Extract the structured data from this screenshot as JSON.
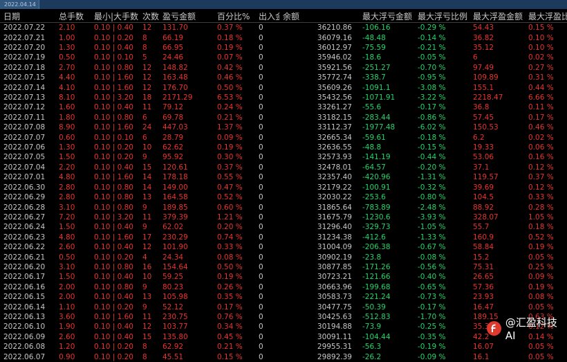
{
  "window": {
    "tab_label": "2022.04.14"
  },
  "columns": [
    "日期",
    "总手数",
    "最小|大手数",
    "次数",
    "盈亏金额",
    "百分比%",
    "出入金",
    "余额",
    "最大浮亏金额",
    "最大浮亏比例",
    "最大浮盈金额",
    "最大浮盈比例"
  ],
  "rows": [
    [
      "2022.07.22",
      "2.10",
      "0.10 | 0.40",
      "12",
      "131.70",
      "0.37 %",
      "0",
      "36210.86",
      "-106.16",
      "-0.29 %",
      "54.43",
      "0.15 %"
    ],
    [
      "2022.07.21",
      "1.00",
      "0.10 | 0.20",
      "8",
      "66.19",
      "0.18 %",
      "0",
      "36079.16",
      "-48.48",
      "-0.14 %",
      "36.82",
      "0.10 %"
    ],
    [
      "2022.07.20",
      "1.30",
      "0.10 | 0.40",
      "8",
      "66.95",
      "0.19 %",
      "0",
      "36012.97",
      "-75.59",
      "-0.21 %",
      "35.12",
      "0.10 %"
    ],
    [
      "2022.07.19",
      "0.50",
      "0.10 | 0.10",
      "5",
      "24.46",
      "0.07 %",
      "0",
      "35946.02",
      "-18.6",
      "-0.05 %",
      "6",
      "0.02 %"
    ],
    [
      "2022.07.18",
      "2.70",
      "0.10 | 0.80",
      "12",
      "148.82",
      "0.42 %",
      "0",
      "35921.56",
      "-251.27",
      "-0.70 %",
      "97.49",
      "0.27 %"
    ],
    [
      "2022.07.15",
      "4.40",
      "0.10 | 1.60",
      "12",
      "163.48",
      "0.46 %",
      "0",
      "35772.74",
      "-338.7",
      "-0.95 %",
      "109.89",
      "0.31 %"
    ],
    [
      "2022.07.14",
      "4.10",
      "0.10 | 1.60",
      "12",
      "176.70",
      "0.50 %",
      "0",
      "35609.26",
      "-1091.1",
      "-3.08 %",
      "155.1",
      "0.44 %"
    ],
    [
      "2022.07.13",
      "8.10",
      "0.10 | 3.20",
      "18",
      "2171.29",
      "6.53 %",
      "0",
      "35432.56",
      "-1071.91",
      "-3.22 %",
      "2218.47",
      "6.66 %"
    ],
    [
      "2022.07.12",
      "1.60",
      "0.10 | 0.40",
      "11",
      "79.12",
      "0.24 %",
      "0",
      "33261.27",
      "-55.6",
      "-0.17 %",
      "36.8",
      "0.11 %"
    ],
    [
      "2022.07.11",
      "1.80",
      "0.10 | 0.80",
      "6",
      "69.78",
      "0.21 %",
      "0",
      "33182.15",
      "-283.44",
      "-0.86 %",
      "57.45",
      "0.17 %"
    ],
    [
      "2022.07.08",
      "8.90",
      "0.10 | 1.60",
      "24",
      "447.03",
      "1.37 %",
      "0",
      "33112.37",
      "-1977.48",
      "-6.02 %",
      "150.53",
      "0.46 %"
    ],
    [
      "2022.07.07",
      "0.60",
      "0.10 | 0.10",
      "6",
      "28.79",
      "0.09 %",
      "0",
      "32665.34",
      "-59.61",
      "-0.18 %",
      "6.2",
      "0.02 %"
    ],
    [
      "2022.07.06",
      "1.30",
      "0.10 | 0.20",
      "10",
      "62.62",
      "0.19 %",
      "0",
      "32636.55",
      "-48.8",
      "-0.15 %",
      "19.33",
      "0.06 %"
    ],
    [
      "2022.07.05",
      "1.50",
      "0.10 | 0.20",
      "9",
      "95.92",
      "0.30 %",
      "0",
      "32573.93",
      "-141.19",
      "-0.44 %",
      "53.06",
      "0.16 %"
    ],
    [
      "2022.07.04",
      "2.20",
      "0.10 | 0.40",
      "15",
      "120.61",
      "0.37 %",
      "0",
      "32478.01",
      "-64.57",
      "-0.20 %",
      "37.1",
      "0.12 %"
    ],
    [
      "2022.07.01",
      "4.80",
      "0.10 | 1.60",
      "14",
      "178.18",
      "0.55 %",
      "0",
      "32357.40",
      "-420.96",
      "-1.31 %",
      "119.57",
      "0.37 %"
    ],
    [
      "2022.06.30",
      "2.80",
      "0.10 | 0.80",
      "14",
      "149.00",
      "0.47 %",
      "0",
      "32179.22",
      "-100.91",
      "-0.32 %",
      "39.69",
      "0.12 %"
    ],
    [
      "2022.06.29",
      "2.80",
      "0.10 | 0.80",
      "13",
      "164.58",
      "0.52 %",
      "0",
      "32030.22",
      "-253.6",
      "-0.80 %",
      "104.5",
      "0.33 %"
    ],
    [
      "2022.06.28",
      "3.10",
      "0.10 | 0.80",
      "9",
      "189.85",
      "0.60 %",
      "0",
      "31865.64",
      "-783.89",
      "-2.48 %",
      "88.92",
      "0.28 %"
    ],
    [
      "2022.06.27",
      "7.20",
      "0.10 | 3.20",
      "11",
      "379.39",
      "1.21 %",
      "0",
      "31675.79",
      "-1230.6",
      "-3.93 %",
      "328.07",
      "1.05 %"
    ],
    [
      "2022.06.24",
      "1.50",
      "0.10 | 0.40",
      "9",
      "62.02",
      "0.20 %",
      "0",
      "31296.40",
      "-329.73",
      "-1.05 %",
      "55.7",
      "0.18 %"
    ],
    [
      "2022.06.23",
      "4.80",
      "0.10 | 1.60",
      "17",
      "230.29",
      "0.74 %",
      "0",
      "31234.38",
      "-412.6",
      "-1.33 %",
      "160.9",
      "0.52 %"
    ],
    [
      "2022.06.22",
      "2.60",
      "0.10 | 0.40",
      "12",
      "101.90",
      "0.33 %",
      "0",
      "31004.09",
      "-206.38",
      "-0.67 %",
      "58.84",
      "0.19 %"
    ],
    [
      "2022.06.21",
      "0.50",
      "0.10 | 0.20",
      "4",
      "24.34",
      "0.08 %",
      "0",
      "30902.19",
      "-23.8",
      "-0.08 %",
      "15.2",
      "0.05 %"
    ],
    [
      "2022.06.20",
      "3.10",
      "0.10 | 0.80",
      "16",
      "154.64",
      "0.50 %",
      "0",
      "30877.85",
      "-171.26",
      "-0.56 %",
      "75.31",
      "0.25 %"
    ],
    [
      "2022.06.17",
      "1.50",
      "0.10 | 0.40",
      "10",
      "59.25",
      "0.19 %",
      "0",
      "30723.21",
      "-121.66",
      "-0.40 %",
      "26.65",
      "0.09 %"
    ],
    [
      "2022.06.16",
      "2.00",
      "0.10 | 0.80",
      "9",
      "80.23",
      "0.26 %",
      "0",
      "30663.96",
      "-199.68",
      "-0.65 %",
      "57.36",
      "0.19 %"
    ],
    [
      "2022.06.15",
      "2.00",
      "0.10 | 0.40",
      "13",
      "105.98",
      "0.35 %",
      "0",
      "30583.73",
      "-221.24",
      "-0.73 %",
      "23.93",
      "0.08 %"
    ],
    [
      "2022.06.14",
      "1.10",
      "0.10 | 0.20",
      "9",
      "52.12",
      "0.17 %",
      "0",
      "30477.75",
      "-50.39",
      "-0.17 %",
      "16.47",
      "0.05 %"
    ],
    [
      "2022.06.13",
      "3.60",
      "0.10 | 1.60",
      "11",
      "230.75",
      "0.76 %",
      "0",
      "30425.63",
      "-512.83",
      "-1.70 %",
      "189.15",
      "0.63 %"
    ],
    [
      "2022.06.10",
      "1.90",
      "0.10 | 0.40",
      "12",
      "103.77",
      "0.34 %",
      "0",
      "30194.88",
      "-73.9",
      "-0.25 %",
      "35.3",
      "0.12 %"
    ],
    [
      "2022.06.09",
      "2.60",
      "0.10 | 0.40",
      "15",
      "135.80",
      "0.45 %",
      "0",
      "30091.11",
      "-104.44",
      "-0.35 %",
      "42.2",
      "0.14 %"
    ],
    [
      "2022.06.08",
      "1.20",
      "0.10 | 0.20",
      "8",
      "62.92",
      "0.21 %",
      "0",
      "29955.31",
      "-56.3",
      "-0.19 %",
      "16.07",
      "0.05 %"
    ],
    [
      "2022.06.07",
      "0.90",
      "0.10 | 0.20",
      "8",
      "45.51",
      "0.15 %",
      "0",
      "29892.39",
      "-26.2",
      "-0.09 %",
      "16.1",
      "0.05 %"
    ]
  ],
  "watermark": {
    "text": "@汇盈科技AI"
  },
  "colors": {
    "profit": "#e8332d",
    "loss": "#20d76a",
    "neutral": "#c8c8c8",
    "background": "#000000"
  }
}
